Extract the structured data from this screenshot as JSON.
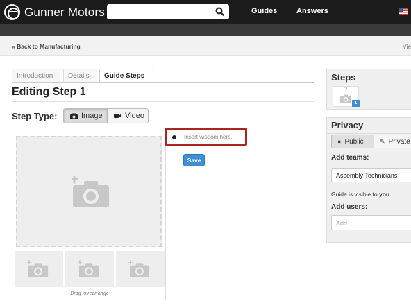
{
  "navbar": {
    "brand": "Gunner Motors",
    "links": [
      "Guides",
      "Answers"
    ],
    "search_icon": "search-icon",
    "flag_icon": "us-flag-icon"
  },
  "breadcrumb": {
    "back": "« Back to Manufacturing",
    "view": "Vie"
  },
  "tabs": [
    "Introduction",
    "Details",
    "Guide Steps"
  ],
  "active_tab": "Guide Steps",
  "page_title": "Editing Step 1",
  "step_type": {
    "label": "Step Type:",
    "options": [
      "Image",
      "Video"
    ],
    "selected": "Image"
  },
  "media": {
    "drag_note": "Drag to rearrange",
    "icon": "add-photo-icon"
  },
  "editor": {
    "bullet_placeholder": "Insert wisdom here.",
    "save_label": "Save"
  },
  "sidebar": {
    "steps_title": "Steps",
    "step_placeholder": "?",
    "step_number": "1",
    "privacy_title": "Privacy",
    "privacy_options": [
      "Public",
      "Private"
    ],
    "privacy_selected": "Public",
    "add_teams_label": "Add teams:",
    "team_value": "Assembly Technicians",
    "visibility_prefix": "Guide is visible to ",
    "visibility_who": "you",
    "visibility_suffix": ".",
    "add_users_label": "Add users:",
    "users_placeholder": "Add..."
  },
  "colors": {
    "navbar": "#1c1c1c",
    "highlight_border": "#a8271a",
    "save_button": "#3d8fd6"
  }
}
